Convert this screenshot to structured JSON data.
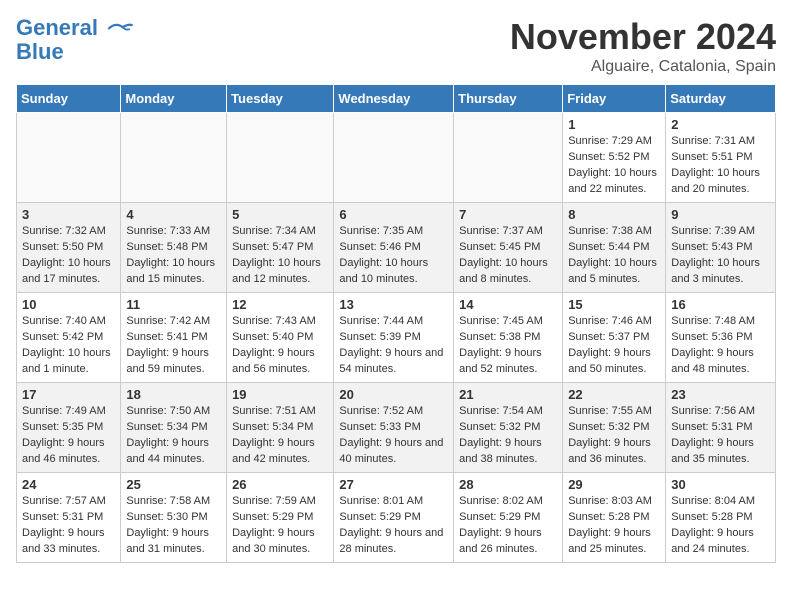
{
  "logo": {
    "line1": "General",
    "line2": "Blue"
  },
  "title": "November 2024",
  "location": "Alguaire, Catalonia, Spain",
  "weekdays": [
    "Sunday",
    "Monday",
    "Tuesday",
    "Wednesday",
    "Thursday",
    "Friday",
    "Saturday"
  ],
  "weeks": [
    [
      {
        "day": "",
        "info": ""
      },
      {
        "day": "",
        "info": ""
      },
      {
        "day": "",
        "info": ""
      },
      {
        "day": "",
        "info": ""
      },
      {
        "day": "",
        "info": ""
      },
      {
        "day": "1",
        "info": "Sunrise: 7:29 AM\nSunset: 5:52 PM\nDaylight: 10 hours and 22 minutes."
      },
      {
        "day": "2",
        "info": "Sunrise: 7:31 AM\nSunset: 5:51 PM\nDaylight: 10 hours and 20 minutes."
      }
    ],
    [
      {
        "day": "3",
        "info": "Sunrise: 7:32 AM\nSunset: 5:50 PM\nDaylight: 10 hours and 17 minutes."
      },
      {
        "day": "4",
        "info": "Sunrise: 7:33 AM\nSunset: 5:48 PM\nDaylight: 10 hours and 15 minutes."
      },
      {
        "day": "5",
        "info": "Sunrise: 7:34 AM\nSunset: 5:47 PM\nDaylight: 10 hours and 12 minutes."
      },
      {
        "day": "6",
        "info": "Sunrise: 7:35 AM\nSunset: 5:46 PM\nDaylight: 10 hours and 10 minutes."
      },
      {
        "day": "7",
        "info": "Sunrise: 7:37 AM\nSunset: 5:45 PM\nDaylight: 10 hours and 8 minutes."
      },
      {
        "day": "8",
        "info": "Sunrise: 7:38 AM\nSunset: 5:44 PM\nDaylight: 10 hours and 5 minutes."
      },
      {
        "day": "9",
        "info": "Sunrise: 7:39 AM\nSunset: 5:43 PM\nDaylight: 10 hours and 3 minutes."
      }
    ],
    [
      {
        "day": "10",
        "info": "Sunrise: 7:40 AM\nSunset: 5:42 PM\nDaylight: 10 hours and 1 minute."
      },
      {
        "day": "11",
        "info": "Sunrise: 7:42 AM\nSunset: 5:41 PM\nDaylight: 9 hours and 59 minutes."
      },
      {
        "day": "12",
        "info": "Sunrise: 7:43 AM\nSunset: 5:40 PM\nDaylight: 9 hours and 56 minutes."
      },
      {
        "day": "13",
        "info": "Sunrise: 7:44 AM\nSunset: 5:39 PM\nDaylight: 9 hours and 54 minutes."
      },
      {
        "day": "14",
        "info": "Sunrise: 7:45 AM\nSunset: 5:38 PM\nDaylight: 9 hours and 52 minutes."
      },
      {
        "day": "15",
        "info": "Sunrise: 7:46 AM\nSunset: 5:37 PM\nDaylight: 9 hours and 50 minutes."
      },
      {
        "day": "16",
        "info": "Sunrise: 7:48 AM\nSunset: 5:36 PM\nDaylight: 9 hours and 48 minutes."
      }
    ],
    [
      {
        "day": "17",
        "info": "Sunrise: 7:49 AM\nSunset: 5:35 PM\nDaylight: 9 hours and 46 minutes."
      },
      {
        "day": "18",
        "info": "Sunrise: 7:50 AM\nSunset: 5:34 PM\nDaylight: 9 hours and 44 minutes."
      },
      {
        "day": "19",
        "info": "Sunrise: 7:51 AM\nSunset: 5:34 PM\nDaylight: 9 hours and 42 minutes."
      },
      {
        "day": "20",
        "info": "Sunrise: 7:52 AM\nSunset: 5:33 PM\nDaylight: 9 hours and 40 minutes."
      },
      {
        "day": "21",
        "info": "Sunrise: 7:54 AM\nSunset: 5:32 PM\nDaylight: 9 hours and 38 minutes."
      },
      {
        "day": "22",
        "info": "Sunrise: 7:55 AM\nSunset: 5:32 PM\nDaylight: 9 hours and 36 minutes."
      },
      {
        "day": "23",
        "info": "Sunrise: 7:56 AM\nSunset: 5:31 PM\nDaylight: 9 hours and 35 minutes."
      }
    ],
    [
      {
        "day": "24",
        "info": "Sunrise: 7:57 AM\nSunset: 5:31 PM\nDaylight: 9 hours and 33 minutes."
      },
      {
        "day": "25",
        "info": "Sunrise: 7:58 AM\nSunset: 5:30 PM\nDaylight: 9 hours and 31 minutes."
      },
      {
        "day": "26",
        "info": "Sunrise: 7:59 AM\nSunset: 5:29 PM\nDaylight: 9 hours and 30 minutes."
      },
      {
        "day": "27",
        "info": "Sunrise: 8:01 AM\nSunset: 5:29 PM\nDaylight: 9 hours and 28 minutes."
      },
      {
        "day": "28",
        "info": "Sunrise: 8:02 AM\nSunset: 5:29 PM\nDaylight: 9 hours and 26 minutes."
      },
      {
        "day": "29",
        "info": "Sunrise: 8:03 AM\nSunset: 5:28 PM\nDaylight: 9 hours and 25 minutes."
      },
      {
        "day": "30",
        "info": "Sunrise: 8:04 AM\nSunset: 5:28 PM\nDaylight: 9 hours and 24 minutes."
      }
    ]
  ]
}
